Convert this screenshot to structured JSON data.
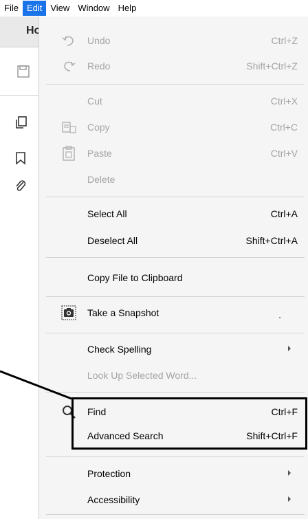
{
  "menubar": {
    "items": [
      {
        "label": "File",
        "active": false
      },
      {
        "label": "Edit",
        "active": true
      },
      {
        "label": "View",
        "active": false
      },
      {
        "label": "Window",
        "active": false
      },
      {
        "label": "Help",
        "active": false
      }
    ]
  },
  "background": {
    "tab_label": "Ho"
  },
  "menu": {
    "undo": {
      "label": "Undo",
      "shortcut": "Ctrl+Z",
      "enabled": false
    },
    "redo": {
      "label": "Redo",
      "shortcut": "Shift+Ctrl+Z",
      "enabled": false
    },
    "cut": {
      "label": "Cut",
      "shortcut": "Ctrl+X",
      "enabled": false
    },
    "copy": {
      "label": "Copy",
      "shortcut": "Ctrl+C",
      "enabled": false
    },
    "paste": {
      "label": "Paste",
      "shortcut": "Ctrl+V",
      "enabled": false
    },
    "delete": {
      "label": "Delete",
      "shortcut": "",
      "enabled": false
    },
    "select_all": {
      "label": "Select All",
      "shortcut": "Ctrl+A",
      "enabled": true
    },
    "deselect_all": {
      "label": "Deselect All",
      "shortcut": "Shift+Ctrl+A",
      "enabled": true
    },
    "copy_file": {
      "label": "Copy File to Clipboard",
      "shortcut": "",
      "enabled": true
    },
    "snapshot": {
      "label": "Take a Snapshot",
      "shortcut": ".",
      "enabled": true
    },
    "check_spelling": {
      "label": "Check Spelling",
      "submenu": true,
      "enabled": true
    },
    "look_up": {
      "label": "Look Up Selected Word...",
      "enabled": false
    },
    "find": {
      "label": "Find",
      "shortcut": "Ctrl+F",
      "enabled": true
    },
    "advanced_search": {
      "label": "Advanced Search",
      "shortcut": "Shift+Ctrl+F",
      "enabled": true
    },
    "protection": {
      "label": "Protection",
      "submenu": true,
      "enabled": true
    },
    "accessibility": {
      "label": "Accessibility",
      "submenu": true,
      "enabled": true
    }
  },
  "colors": {
    "menubar_active_bg": "#1a73e8",
    "menu_bg": "#f5f5f5",
    "disabled_text": "#a4a4a4",
    "highlight_border": "#000000"
  }
}
